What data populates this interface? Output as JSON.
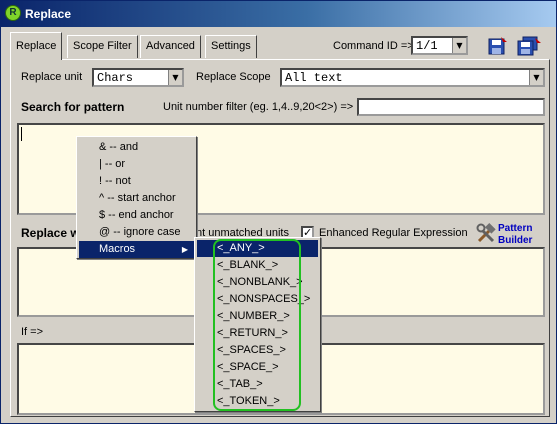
{
  "window": {
    "title": "Replace",
    "icon": "replace-app-icon"
  },
  "tabs": [
    {
      "label": "Replace",
      "active": true
    },
    {
      "label": "Scope Filter",
      "active": false
    },
    {
      "label": "Advanced",
      "active": false
    },
    {
      "label": "Settings",
      "active": false
    }
  ],
  "command_id": {
    "label": "Command ID =>",
    "value": "1/1"
  },
  "toolbar": {
    "save_icon": "floppy-disk-icon",
    "save_all_icon": "floppy-disks-icon"
  },
  "replace_unit": {
    "label": "Replace unit",
    "value": "Chars"
  },
  "replace_scope": {
    "label": "Replace Scope",
    "value": "All text"
  },
  "search": {
    "label": "Search for pattern",
    "filter_label": "Unit number filter (eg. 1,4..9,20<2>) =>",
    "filter_value": "",
    "pattern_value": ""
  },
  "replace_with": {
    "label_visible": "Replace w",
    "unmatched_visible": "nt unmatched units",
    "value": ""
  },
  "enhanced_regex": {
    "label": "Enhanced Regular Expression",
    "checked": true,
    "check_glyph": "✓"
  },
  "pattern_builder": {
    "line1": "Pattern",
    "line2": "Builder",
    "icon": "hammer-wrench-icon"
  },
  "if_section": {
    "label": "If =>",
    "value": ""
  },
  "context_menu": {
    "items": [
      "& -- and",
      "| -- or",
      "! -- not",
      "^ -- start anchor",
      "$ -- end anchor",
      "@ -- ignore case",
      "Macros"
    ],
    "arrow": "▶"
  },
  "macros_menu": {
    "items": [
      "<_ANY_>",
      "<_BLANK_>",
      "<_NONBLANK_>",
      "<_NONSPACES_>",
      "<_NUMBER_>",
      "<_RETURN_>",
      "<_SPACES_>",
      "<_SPACE_>",
      "<_TAB_>",
      "<_TOKEN_>"
    ],
    "selected": "<_ANY_>"
  },
  "colors": {
    "title_start": "#0a246a",
    "title_end": "#a6caf0",
    "face": "#d4d0c8",
    "input_bg": "#fffbe6",
    "selection": "#0a246a",
    "highlight_outline": "#22c022"
  }
}
